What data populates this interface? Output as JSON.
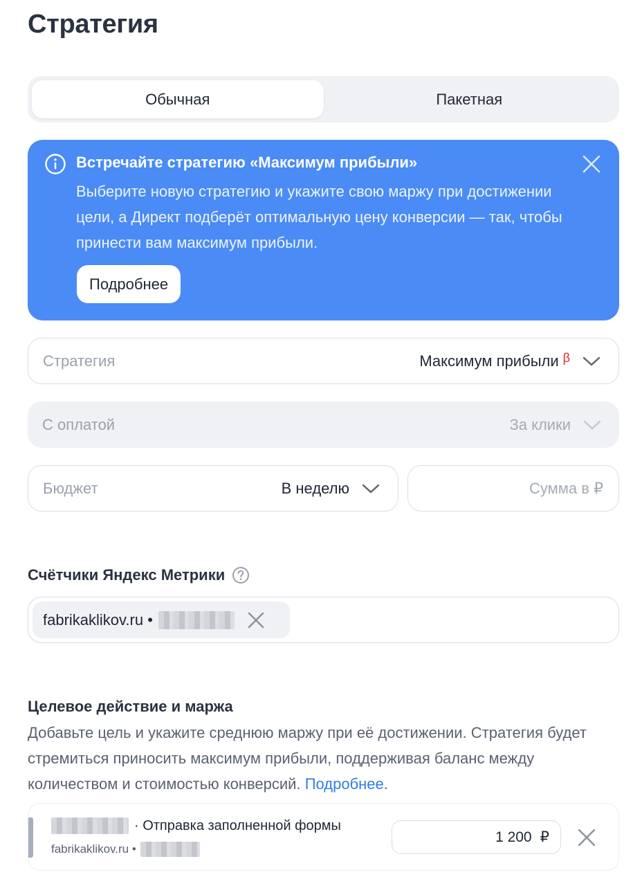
{
  "page": {
    "title": "Стратегия"
  },
  "strategy_tabs": [
    {
      "label": "Обычная",
      "active": true
    },
    {
      "label": "Пакетная",
      "active": false
    }
  ],
  "banner": {
    "title": "Встречайте стратегию «Максимум прибыли»",
    "text": "Выберите новую стратегию и укажите свою маржу при достижении цели, а Директ подберёт оптимальную цену конверсии — так, чтобы принести вам максимум прибыли.",
    "button_label": "Подробнее",
    "background": "#4a8bf5"
  },
  "strategy_field": {
    "label": "Стратегия",
    "value": "Максимум прибыли",
    "badge": "β"
  },
  "payment_field": {
    "label": "С оплатой",
    "value": "За клики"
  },
  "budget_field": {
    "label": "Бюджет",
    "value": "В неделю"
  },
  "sum_field": {
    "placeholder": "Сумма в ₽"
  },
  "metrika": {
    "title": "Счётчики Яндекс Метрики",
    "counter_text": "fabrikaklikov.ru •"
  },
  "goal_section": {
    "title": "Целевое действие и маржа",
    "description": "Добавьте цель и укажите среднюю маржу при её достижении. Стратегия будет стремиться приносить максимум прибыли, поддерживая баланс между количеством и стоимостью конверсий. ",
    "link_label": "Подробнее",
    "goal": {
      "name": "· Отправка заполненной формы",
      "site": "fabrikaklikov.ru •",
      "margin_value": "1 200",
      "currency": "₽"
    }
  },
  "colors": {
    "accent_link": "#2f7de1",
    "beta_badge": "#e0262b"
  }
}
